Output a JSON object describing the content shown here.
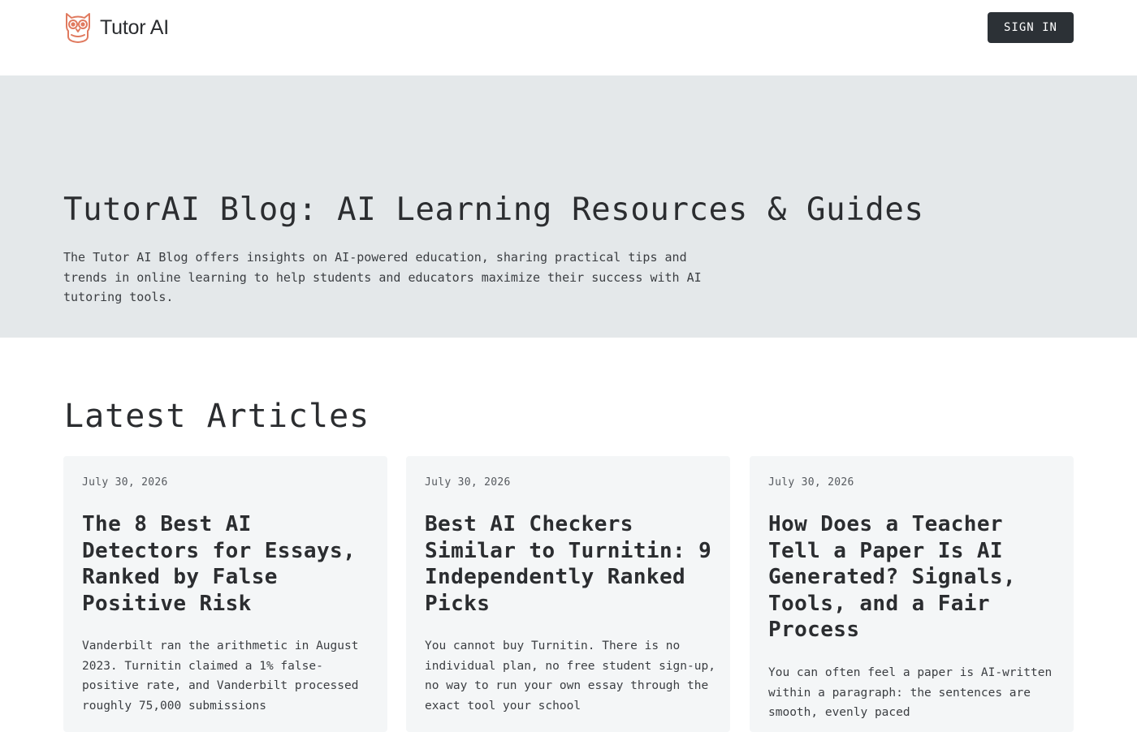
{
  "header": {
    "brand_name": "Tutor AI",
    "sign_in_label": "SIGN IN",
    "logo_icon": "owl-icon",
    "logo_color": "#e07a5f"
  },
  "hero": {
    "title": "TutorAI Blog: AI Learning Resources & Guides",
    "description": "The Tutor AI Blog offers insights on AI-powered education, sharing practical tips and trends in online learning to help students and educators maximize their success with AI tutoring tools."
  },
  "latest": {
    "heading": "Latest Articles",
    "articles": [
      {
        "date": "July 30, 2026",
        "title": "The 8 Best AI Detectors for Essays, Ranked by False Positive Risk",
        "excerpt": "Vanderbilt ran the arithmetic in August 2023. Turnitin claimed a 1% false-positive rate, and Vanderbilt processed roughly 75,000 submissions"
      },
      {
        "date": "July 30, 2026",
        "title": "Best AI Checkers Similar to Turnitin: 9 Independently Ranked Picks",
        "excerpt": "You cannot buy Turnitin. There is no individual plan, no free student sign-up, no way to run your own essay through the exact tool your school"
      },
      {
        "date": "July 30, 2026",
        "title": "How Does a Teacher Tell a Paper Is AI Generated? Signals, Tools, and a Fair Process",
        "excerpt": "You can often feel a paper is AI-written within a paragraph: the sentences are smooth, evenly paced"
      }
    ]
  },
  "colors": {
    "hero_background": "#e4e8ea",
    "card_background": "#f4f6f7",
    "button_background": "#2c3136",
    "text": "#2b2d30"
  }
}
